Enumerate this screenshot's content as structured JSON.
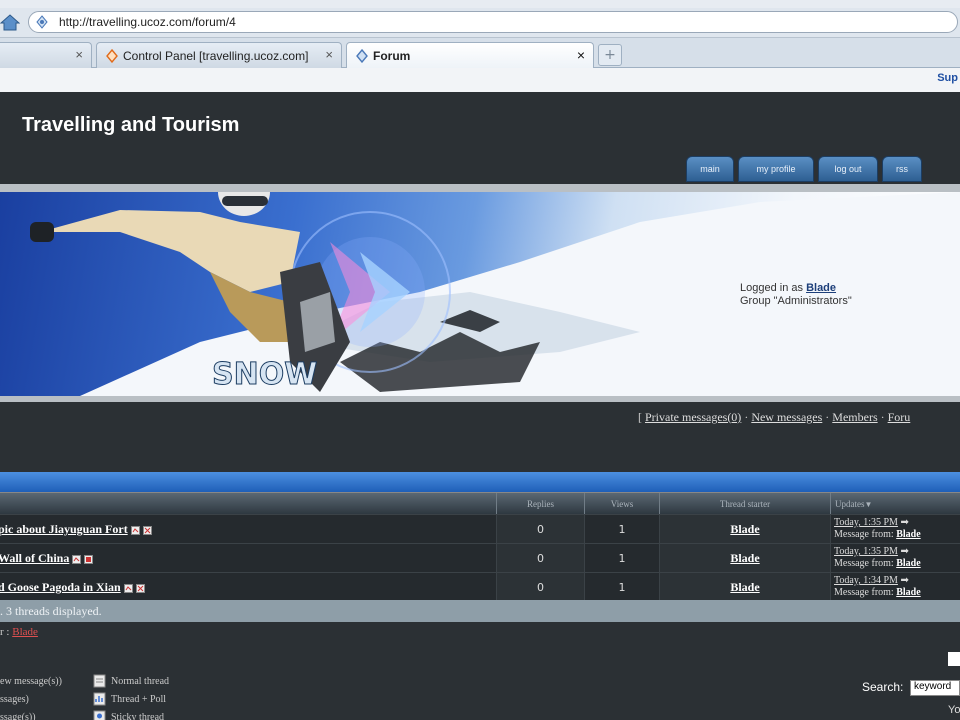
{
  "browser": {
    "address_url": "http://travelling.ucoz.com/forum/4",
    "tabs": [
      {
        "label": "",
        "close": "×"
      },
      {
        "label": "Control Panel [travelling.ucoz.com]",
        "close": "×"
      },
      {
        "label": "Forum",
        "close": "×"
      }
    ],
    "new_tab": "+",
    "bookmark_right": "Sup"
  },
  "site": {
    "title": "Travelling and Tourism",
    "nav": [
      "main",
      "my profile",
      "log out",
      "rss"
    ],
    "banner_text": "SNOW",
    "login": {
      "prefix": "Logged in as",
      "user": "Blade",
      "group": "Group \"Administrators\""
    }
  },
  "links": {
    "open_bracket": "[",
    "items": [
      "Private messages(0)",
      "New messages",
      "Members",
      "Foru"
    ],
    "sep": "·"
  },
  "table": {
    "headers": {
      "replies": "Replies",
      "views": "Views",
      "starter": "Thread starter",
      "updates": "Updates"
    },
    "rows": [
      {
        "topic": "pic about Jiayuguan Fort",
        "replies": "0",
        "views": "1",
        "starter": "Blade",
        "time": "Today, 1:35 PM",
        "from_label": "Message from:",
        "from_user": "Blade"
      },
      {
        "topic": "Wall of China",
        "replies": "0",
        "views": "1",
        "starter": "Blade",
        "time": "Today, 1:35 PM",
        "from_label": "Message from:",
        "from_user": "Blade"
      },
      {
        "topic": "d Goose Pagoda in Xian",
        "replies": "0",
        "views": "1",
        "starter": "Blade",
        "time": "Today, 1:34 PM",
        "from_label": "Message from:",
        "from_user": "Blade"
      }
    ],
    "footer": ". 3 threads displayed.",
    "moderator_prefix": "r :",
    "moderator_user": "Blade"
  },
  "legend": {
    "items": [
      {
        "label": "ew message(s))"
      },
      {
        "label": "ssages)"
      },
      {
        "label": "ssage(s))"
      },
      {
        "label": "Normal thread"
      },
      {
        "label": "Thread + Poll"
      },
      {
        "label": "Sticky thread"
      }
    ]
  },
  "search": {
    "label": "Search:",
    "value": "keyword"
  },
  "misc": {
    "bottom_right": "Yo"
  }
}
